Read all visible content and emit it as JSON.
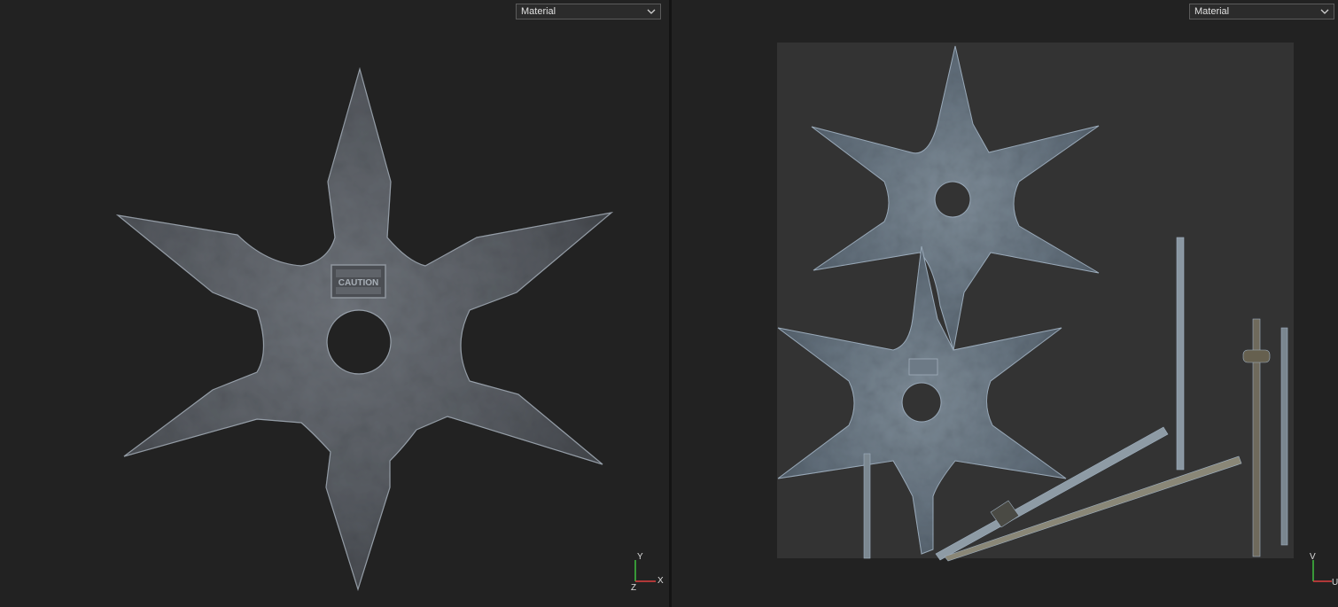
{
  "left_viewport": {
    "mode_select": {
      "value": "Material",
      "icon": "chevron-down-icon"
    },
    "model_label": "CAUTION",
    "axis": {
      "up": "Y",
      "right": "X",
      "depth": "Z"
    }
  },
  "right_viewport": {
    "mode_select": {
      "value": "Material",
      "icon": "chevron-down-icon"
    },
    "axis": {
      "up": "V",
      "right": "U"
    }
  },
  "colors": {
    "viewport_bg": "#222222",
    "uv_sheet_bg": "#333333",
    "divider": "#141414",
    "axis_x": "#e04040",
    "axis_y": "#40c040",
    "axis_z": "#4060e0"
  }
}
